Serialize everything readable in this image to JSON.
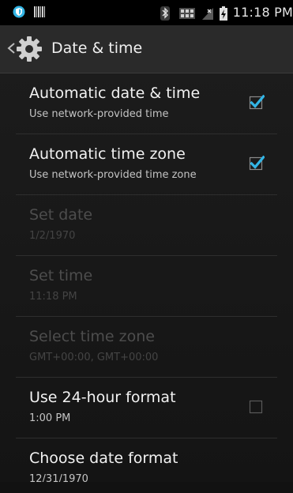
{
  "status_bar": {
    "time": "11:18 PM",
    "left_icons": [
      "shield-notification-icon",
      "barcode-notification-icon"
    ],
    "right_icons": [
      "bluetooth-icon",
      "network-icon",
      "signal-no-sim-icon",
      "battery-charging-icon"
    ]
  },
  "action_bar": {
    "title": "Date & time",
    "icon": "settings-gear-icon"
  },
  "preferences": [
    {
      "title": "Automatic date & time",
      "summary": "Use network-provided time",
      "enabled": true,
      "checkbox": "checked"
    },
    {
      "title": "Automatic time zone",
      "summary": "Use network-provided time zone",
      "enabled": true,
      "checkbox": "checked"
    },
    {
      "title": "Set date",
      "summary": "1/2/1970",
      "enabled": false
    },
    {
      "title": "Set time",
      "summary": "11:18 PM",
      "enabled": false
    },
    {
      "title": "Select time zone",
      "summary": "GMT+00:00, GMT+00:00",
      "enabled": false
    },
    {
      "title": "Use 24-hour format",
      "summary": "1:00 PM",
      "enabled": true,
      "checkbox": "unchecked"
    },
    {
      "title": "Choose date format",
      "summary": "12/31/1970",
      "enabled": true
    }
  ],
  "colors": {
    "accent": "#33b5e5",
    "background": "#1a1a1a",
    "action_bar": "#2a2a2a",
    "status_bar": "#000000"
  }
}
